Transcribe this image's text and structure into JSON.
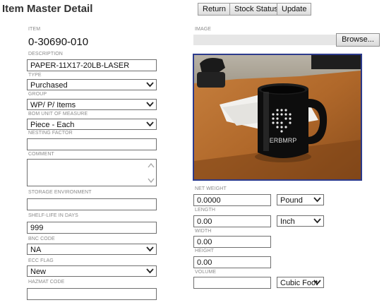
{
  "header": {
    "title": "Item Master Detail",
    "buttons": {
      "return": "Return",
      "stock_status": "Stock Status",
      "update": "Update"
    }
  },
  "left": {
    "item": {
      "label": "ITEM",
      "value": "0-30690-010"
    },
    "description": {
      "label": "DESCRIPTION",
      "value": "PAPER-11X17-20LB-LASER"
    },
    "type": {
      "label": "TYPE",
      "value": "Purchased"
    },
    "group": {
      "label": "GROUP",
      "value": "WP/ P/ Items"
    },
    "bom_uom": {
      "label": "BOM UNIT OF MEASURE",
      "value": "Piece - Each"
    },
    "nesting_factor": {
      "label": "NESTING FACTOR",
      "value": ""
    },
    "comment": {
      "label": "COMMENT",
      "value": ""
    },
    "storage_env": {
      "label": "STORAGE ENVIRONMENT",
      "value": ""
    },
    "shelf_life": {
      "label": "SHELF-LIFE IN DAYS",
      "value": "999"
    },
    "bnc_code": {
      "label": "BNC CODE",
      "value": "NA"
    },
    "ecc_flag": {
      "label": "ECC FLAG",
      "value": "New"
    },
    "hazmat_code": {
      "label": "HAZMAT CODE",
      "value": ""
    }
  },
  "right": {
    "image": {
      "label": "IMAGE",
      "browse_label": "Browse...",
      "mug_text": "ERBMRP"
    },
    "net_weight": {
      "label": "NET WEIGHT",
      "value": "0.0000",
      "unit": "Pound"
    },
    "length": {
      "label": "LENGTH",
      "value": "0.00",
      "unit": "Inch"
    },
    "width": {
      "label": "WIDTH",
      "value": "0.00"
    },
    "height": {
      "label": "HEIGHT",
      "value": "0.00"
    },
    "volume": {
      "label": "VOLUME",
      "value": "",
      "unit": "Cubic Foot"
    }
  },
  "icons": {
    "dropdown": "chevron-down-icon",
    "scroll_up": "scroll-up-icon",
    "scroll_down": "scroll-down-icon"
  }
}
